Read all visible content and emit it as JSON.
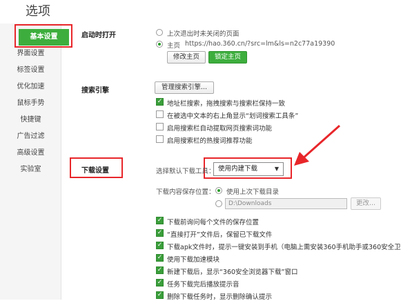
{
  "window": {
    "title": "选项"
  },
  "sidebar": {
    "items": [
      {
        "label": "基本设置"
      },
      {
        "label": "界面设置"
      },
      {
        "label": "标签设置"
      },
      {
        "label": "优化加速"
      },
      {
        "label": "鼠标手势"
      },
      {
        "label": "快捷键"
      },
      {
        "label": "广告过滤"
      },
      {
        "label": "高级设置"
      },
      {
        "label": "实验室"
      }
    ]
  },
  "startup": {
    "title": "启动时打开",
    "option_last": "上次退出时未关闭的页面",
    "option_home": "主页",
    "home_url": "https://hao.360.cn/?src=lm&ls=n2c77a19390",
    "btn_modify": "修改主页",
    "btn_lock": "锁定主页"
  },
  "search": {
    "title": "搜索引擎",
    "btn_manage": "管理搜索引擎...",
    "options": [
      {
        "label": "地址栏搜索，拖拽搜索与搜索栏保持一致",
        "checked": true
      },
      {
        "label": "在被选中文本的右上角显示“划词搜索工具条”",
        "checked": false
      },
      {
        "label": "启用搜索栏自动提取网页搜索词功能",
        "checked": false
      },
      {
        "label": "启用搜索栏的热搜词推荐功能",
        "checked": false
      }
    ]
  },
  "download": {
    "title": "下载设置",
    "tool_label": "选择默认下载工具：",
    "tool_value": "使用内建下载",
    "save_label": "下载内容保存位置：",
    "save_last": "使用上次下载目录",
    "save_path": "D:\\Downloads",
    "btn_change": "更改...",
    "options": [
      {
        "label": "下载前询问每个文件的保存位置",
        "checked": true
      },
      {
        "label": "“直接打开”文件后，保留已下载文件",
        "checked": true
      },
      {
        "label": "下载apk文件时，提示一键安装到手机（电脑上需安装360手机助手或360安全卫士）",
        "checked": true
      },
      {
        "label": "使用下载加速模块",
        "checked": true
      },
      {
        "label": "新建下载后，显示“360安全浏览器下载”窗口",
        "checked": true
      },
      {
        "label": "任务下载完后播放提示音",
        "checked": true
      },
      {
        "label": "删除下载任务时，显示删除确认提示",
        "checked": true
      }
    ]
  },
  "colors": {
    "accent": "#3dae3d",
    "highlight": "#e8262a"
  }
}
